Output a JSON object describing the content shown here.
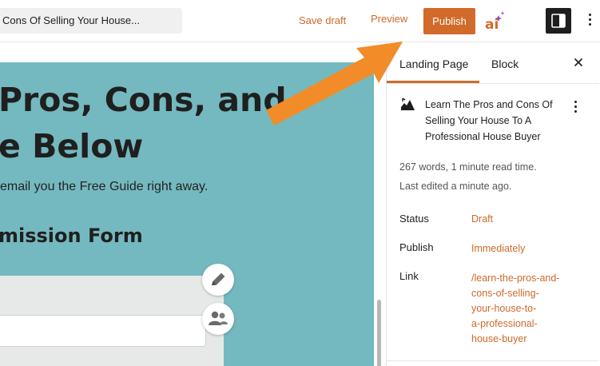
{
  "topbar": {
    "document_title": "Cons Of Selling Your House...",
    "save_draft_label": "Save draft",
    "preview_label": "Preview",
    "publish_label": "Publish",
    "ai_label": "ai",
    "accent_color": "#d16a2a"
  },
  "canvas": {
    "hero_title_lines": [
      "Pros, Cons, and",
      "e Below"
    ],
    "hero_subtitle": "email you the Free Guide right away.",
    "form_heading": "mission Form",
    "background_color": "#74b9bf"
  },
  "sidebar": {
    "tabs": [
      {
        "label": "Landing Page",
        "active": true
      },
      {
        "label": "Block",
        "active": false
      }
    ],
    "document": {
      "title": "Learn The Pros and Cons Of Selling Your House To A Professional House Buyer",
      "word_count_text": "267 words, 1 minute read time.",
      "last_edited_text": "Last edited a minute ago."
    },
    "rows": {
      "status": {
        "label": "Status",
        "value": "Draft"
      },
      "publish": {
        "label": "Publish",
        "value": "Immediately"
      },
      "link": {
        "label": "Link",
        "value_lines": [
          "/learn-the-pros-and-",
          "cons-of-selling-",
          "your-house-to-",
          "a-professional-",
          "house-buyer"
        ]
      }
    }
  },
  "icons": [
    "ai-sparkle-icon",
    "sidebar-toggle-icon",
    "more-options-icon",
    "close-icon",
    "landing-page-icon",
    "pencil-icon",
    "users-icon",
    "annotation-arrow"
  ]
}
